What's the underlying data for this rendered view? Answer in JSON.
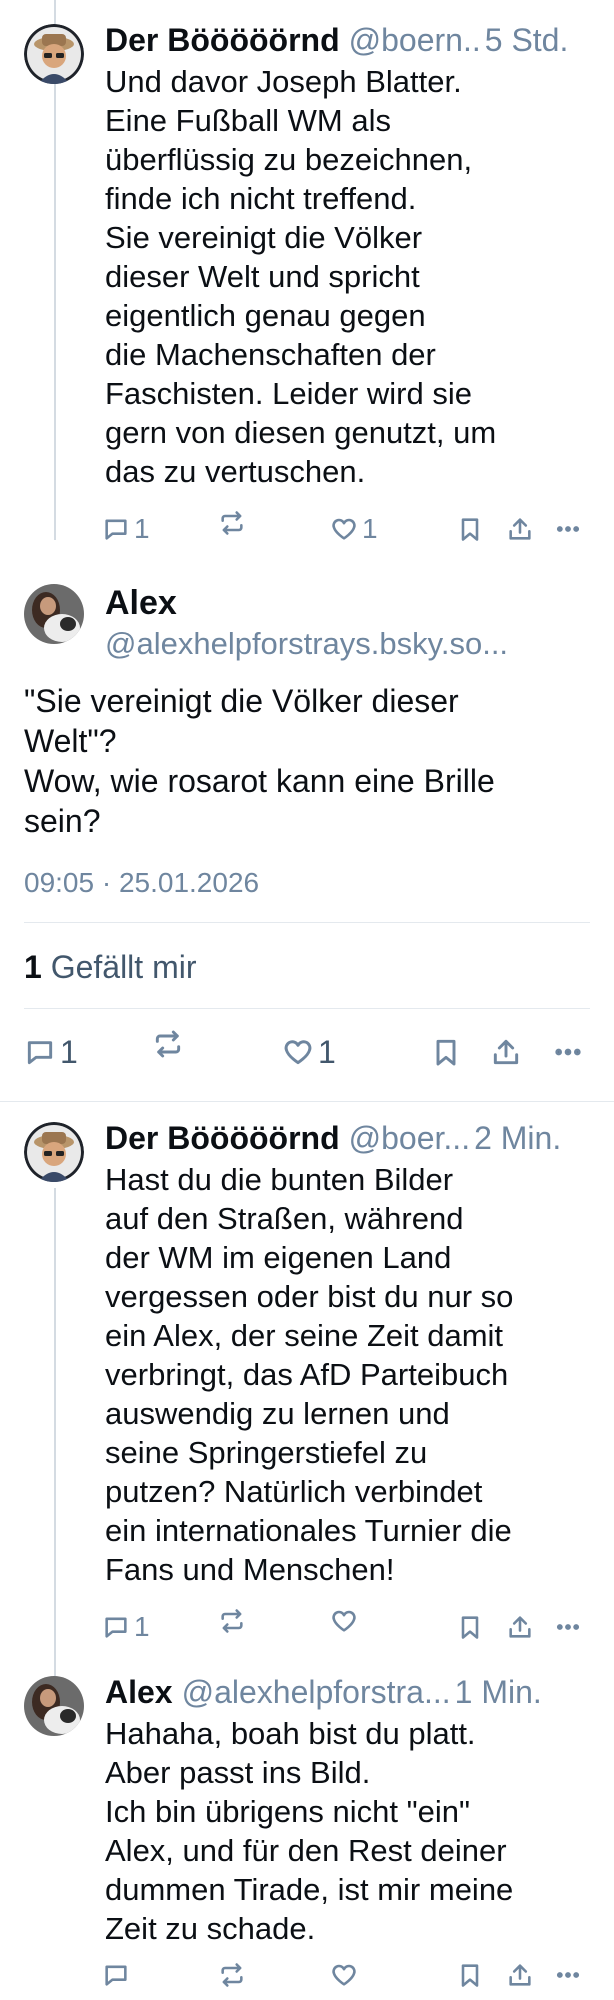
{
  "posts": [
    {
      "name": "Der Bööööörnd",
      "handle": "@boern..",
      "time": "5 Std.",
      "text": "Und davor Joseph Blatter.\nEine Fußball WM als\nüberflüssig zu bezeichnen,\nfinde ich nicht treffend.\nSie vereinigt die Völker\ndieser Welt und spricht\neigentlich genau gegen\ndie Machenschaften der\nFaschisten. Leider wird sie\ngern von diesen genutzt, um\ndas zu vertuschen.",
      "replies": "1",
      "likes": "1"
    },
    {
      "name": "Der Bööööörnd",
      "handle": "@boer...",
      "time": "2 Min.",
      "text": "Hast du die bunten Bilder\nauf den Straßen, während\nder WM im eigenen Land\nvergessen oder bist du nur so\nein Alex, der seine Zeit damit\nverbringt, das AfD Parteibuch\nauswendig zu lernen und\nseine Springerstiefel zu\nputzen? Natürlich verbindet\nein internationales Turnier die\nFans und Menschen!",
      "replies": "1",
      "likes": ""
    },
    {
      "name": "Alex",
      "handle": "@alexhelpforstra...",
      "time": "1 Min.",
      "text": "Hahaha, boah bist du platt.\nAber passt ins Bild.\nIch bin übrigens nicht \"ein\"\nAlex, und für den Rest deiner\ndummen Tirade, ist mir meine\nZeit zu schade.",
      "replies": "",
      "likes": ""
    }
  ],
  "focus": {
    "name": "Alex",
    "handle": "@alexhelpforstrays.bsky.so...",
    "text": "\"Sie vereinigt die Völker dieser\nWelt\"?\nWow, wie rosarot kann eine Brille\nsein?",
    "datetime": "09:05 · 25.01.2026",
    "like_count": "1",
    "like_label": "Gefällt mir",
    "replies": "1",
    "likes": "1"
  },
  "icons": {
    "reply": "speech-bubble-icon",
    "repost": "repost-arrows-icon",
    "like": "heart-icon",
    "bookmark": "bookmark-icon",
    "share": "share-icon",
    "more": "ellipsis-icon"
  },
  "colors": {
    "text": "#0b0f14",
    "muted": "#6f869f",
    "divider": "#e4e9ee",
    "thread_line": "#d4dbe2"
  }
}
